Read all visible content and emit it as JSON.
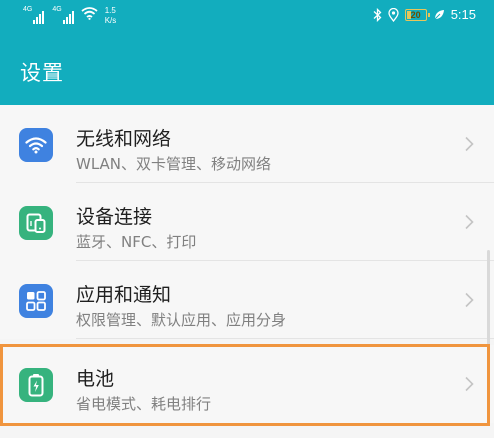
{
  "status_bar": {
    "sim1_tag": "4G",
    "sim2_tag": "4G",
    "speed_value": "1.5",
    "speed_unit": "K/s",
    "battery_level": "20",
    "battery_fraction": 0.2,
    "time": "5:15",
    "icons": [
      "signal-icon",
      "signal-icon",
      "wifi-icon",
      "bluetooth-icon",
      "location-icon",
      "battery-icon",
      "leaf-icon"
    ]
  },
  "header": {
    "title": "设置"
  },
  "settings_items": [
    {
      "title": "无线和网络",
      "subtitle": "WLAN、双卡管理、移动网络",
      "icon": "wifi-icon",
      "icon_color": "#3f82e0"
    },
    {
      "title": "设备连接",
      "subtitle": "蓝牙、NFC、打印",
      "icon": "device-connection-icon",
      "icon_color": "#36b37e"
    },
    {
      "title": "应用和通知",
      "subtitle": "权限管理、默认应用、应用分身",
      "icon": "apps-icon",
      "icon_color": "#3f82e0"
    },
    {
      "title": "电池",
      "subtitle": "省电模式、耗电排行",
      "icon": "battery-icon",
      "icon_color": "#36b37e"
    }
  ],
  "colors": {
    "accent": "#12adbe",
    "highlight_border": "#f0953e",
    "battery_status": "#e8c65a"
  }
}
